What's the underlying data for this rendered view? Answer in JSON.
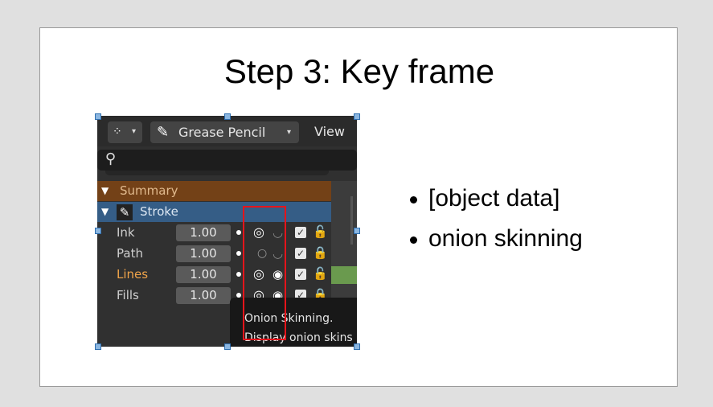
{
  "slide": {
    "title": "Step 3: Key frame",
    "bullets": [
      "[object data]",
      "onion skinning"
    ]
  },
  "screenshot": {
    "toolbar": {
      "mode_icon": "grease-pencil-mode-icon",
      "editor_label": "Grease Pencil",
      "view_menu": "View"
    },
    "search": {
      "icon": "search-icon"
    },
    "summary": {
      "label": "Summary"
    },
    "object": {
      "label": "Stroke"
    },
    "layers": [
      {
        "name": "Ink",
        "opacity": "1.00",
        "onion": true,
        "visible": false,
        "locked": false,
        "active": false
      },
      {
        "name": "Path",
        "opacity": "1.00",
        "onion": false,
        "visible": false,
        "locked": true,
        "active": false
      },
      {
        "name": "Lines",
        "opacity": "1.00",
        "onion": true,
        "visible": true,
        "locked": false,
        "active": true
      },
      {
        "name": "Fills",
        "opacity": "1.00",
        "onion": true,
        "visible": true,
        "locked": true,
        "active": false
      }
    ],
    "tooltip": {
      "title": "Onion Skinning.",
      "description": "Display onion skins"
    },
    "colors": {
      "summary_bg": "#734117",
      "stroke_bg": "#355d86",
      "active_layer_text": "#f0a44a",
      "highlight_box": "#e5141b",
      "keyframe": "#6a9a4e"
    }
  }
}
